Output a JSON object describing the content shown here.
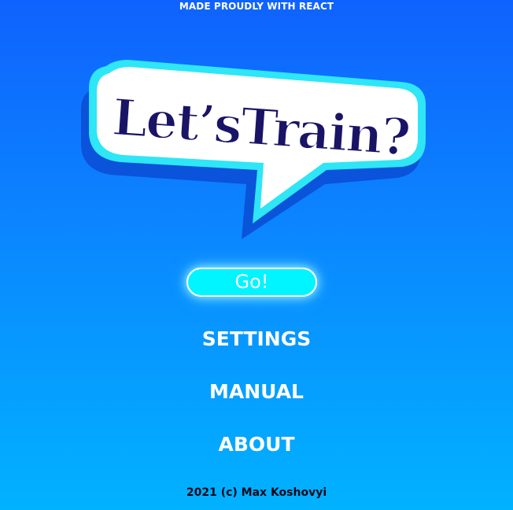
{
  "header": {
    "note": "MADE PROUDLY WITH REACT"
  },
  "logo": {
    "text": "Let’sTrain?",
    "colors": {
      "bubble_fill": "#ffffff",
      "bubble_outline": "#2ee6f5",
      "bubble_shadow": "#0a4fd6",
      "text_fill": "#1a1466",
      "text_stroke": "#ffffff"
    }
  },
  "menu": {
    "go_label": "Go!",
    "settings_label": "SETTINGS",
    "manual_label": "MANUAL",
    "about_label": "ABOUT"
  },
  "footer": {
    "copyright": "2021 (c) Max Koshovyi"
  },
  "theme": {
    "bg_top": "#0f62fe",
    "bg_bottom": "#01b2ff",
    "go_button": "#00f5ff"
  }
}
